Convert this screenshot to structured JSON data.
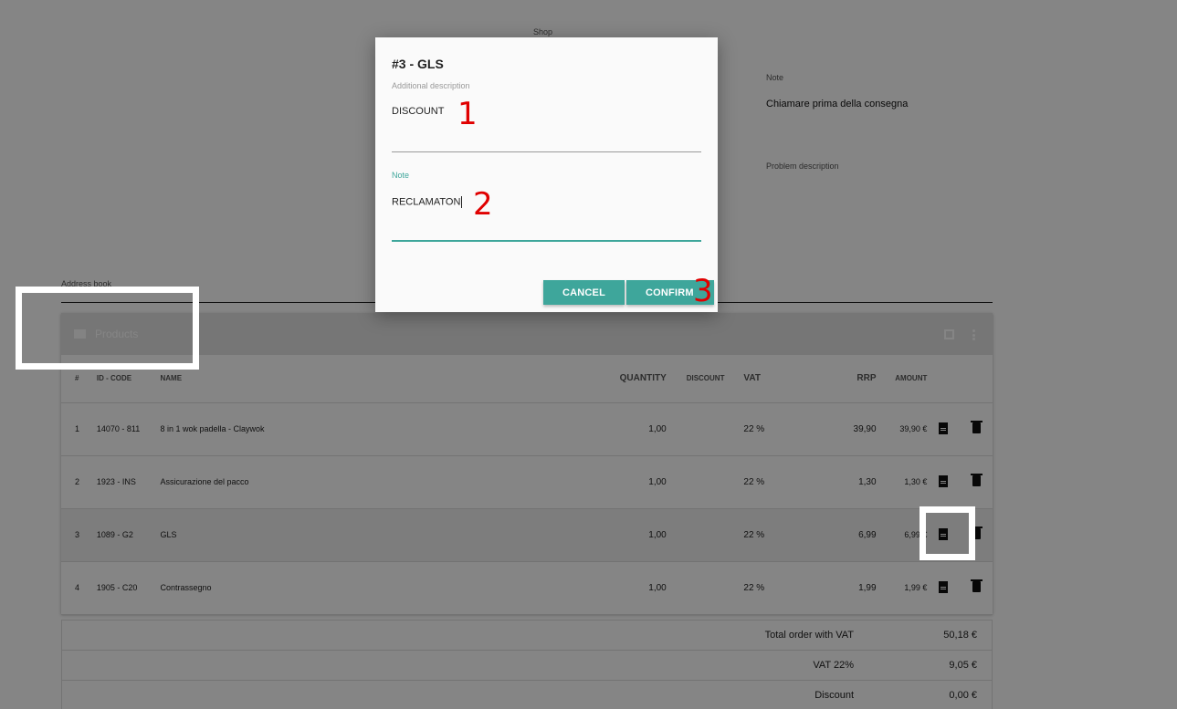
{
  "background": {
    "shop_label": "Shop",
    "note_label": "Note",
    "note_value": "Chiamare prima della consegna",
    "problem_label": "Problem description",
    "address_label": "Address book",
    "products": {
      "title": "Products",
      "columns": [
        "#",
        "ID - CODE",
        "NAME",
        "QUANTITY",
        "DISCOUNT",
        "VAT",
        "RRP",
        "AMOUNT"
      ],
      "rows": [
        {
          "idx": "1",
          "id": "14070 - 811",
          "name": "8 in 1 wok padella - Claywok",
          "qty": "1,00",
          "discount": "",
          "vat": "22 %",
          "rrp": "39,90",
          "amount": "39,90 €"
        },
        {
          "idx": "2",
          "id": "1923 - INS",
          "name": "Assicurazione del pacco",
          "qty": "1,00",
          "discount": "",
          "vat": "22 %",
          "rrp": "1,30",
          "amount": "1,30 €"
        },
        {
          "idx": "3",
          "id": "1089 - G2",
          "name": "GLS",
          "qty": "1,00",
          "discount": "",
          "vat": "22 %",
          "rrp": "6,99",
          "amount": "6,99 €"
        },
        {
          "idx": "4",
          "id": "1905 - C20",
          "name": "Contrassegno",
          "qty": "1,00",
          "discount": "",
          "vat": "22 %",
          "rrp": "1,99",
          "amount": "1,99 €"
        }
      ]
    },
    "totals": [
      {
        "label": "Total order with VAT",
        "value": "50,18 €"
      },
      {
        "label": "VAT 22%",
        "value": "9,05 €"
      },
      {
        "label": "Discount",
        "value": "0,00 €"
      }
    ]
  },
  "dialog": {
    "title": "#3 - GLS",
    "additional_description_label": "Additional description",
    "additional_description_value": "DISCOUNT",
    "note_label": "Note",
    "note_value": "RECLAMATON",
    "cancel_label": "CANCEL",
    "confirm_label": "CONFIRM"
  },
  "annotations": {
    "mark_1": "1",
    "mark_2": "2",
    "mark_3": "3"
  },
  "colors": {
    "accent": "#3ea69b",
    "annotation": "#e00000",
    "overlay": "#000000"
  }
}
